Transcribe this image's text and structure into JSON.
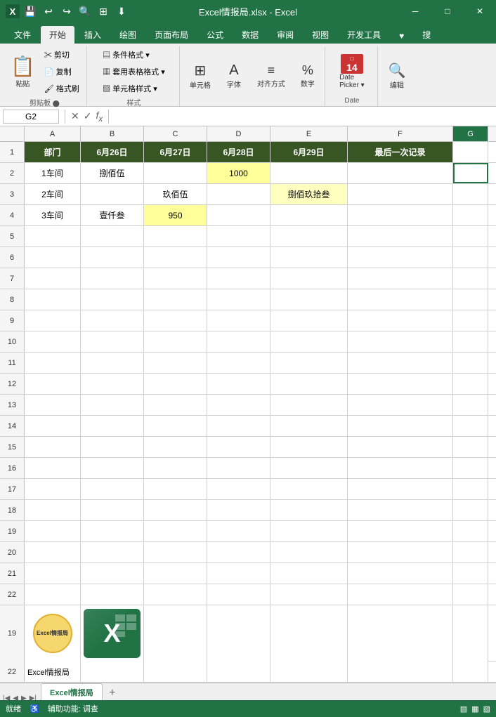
{
  "titlebar": {
    "title": "Excel情报局.xlsx - Excel",
    "min": "─",
    "max": "□",
    "close": "✕"
  },
  "ribbon": {
    "tabs": [
      "文件",
      "开始",
      "插入",
      "绘图",
      "页面布局",
      "公式",
      "数据",
      "审阅",
      "视图",
      "开发工具",
      "♥",
      "搜"
    ],
    "active_tab": "开始",
    "groups": [
      {
        "name": "剪贴板",
        "items": [
          "粘贴",
          "剪切",
          "复制",
          "格式刷"
        ]
      },
      {
        "name": "样式",
        "items": [
          "条件格式▾",
          "套用表格格式▾",
          "单元格样式▾"
        ]
      },
      {
        "name": "",
        "items": [
          "单元格",
          "字体",
          "对齐方式",
          "数字"
        ]
      },
      {
        "name": "Date",
        "items": [
          "DatePicker▾"
        ]
      },
      {
        "name": "",
        "items": [
          "编辑"
        ]
      }
    ]
  },
  "formula_bar": {
    "cell_ref": "G2",
    "formula": ""
  },
  "columns": {
    "headers": [
      "A",
      "B",
      "C",
      "D",
      "E",
      "F",
      "G"
    ]
  },
  "rows": [
    {
      "row_num": "1",
      "cells": [
        {
          "col": "A",
          "value": "部门",
          "style": "header"
        },
        {
          "col": "B",
          "value": "6月26日",
          "style": "header"
        },
        {
          "col": "C",
          "value": "6月27日",
          "style": "header"
        },
        {
          "col": "D",
          "value": "6月28日",
          "style": "header"
        },
        {
          "col": "E",
          "value": "6月29日",
          "style": "header"
        },
        {
          "col": "F",
          "value": "最后一次记录",
          "style": "header"
        },
        {
          "col": "G",
          "value": "",
          "style": "normal"
        }
      ]
    },
    {
      "row_num": "2",
      "cells": [
        {
          "col": "A",
          "value": "1车间",
          "style": "normal"
        },
        {
          "col": "B",
          "value": "捌佰伍",
          "style": "normal"
        },
        {
          "col": "C",
          "value": "",
          "style": "normal"
        },
        {
          "col": "D",
          "value": "1000",
          "style": "highlight-yellow"
        },
        {
          "col": "E",
          "value": "",
          "style": "normal"
        },
        {
          "col": "F",
          "value": "",
          "style": "normal"
        },
        {
          "col": "G",
          "value": "",
          "style": "selected-cell"
        }
      ]
    },
    {
      "row_num": "3",
      "cells": [
        {
          "col": "A",
          "value": "2车间",
          "style": "normal"
        },
        {
          "col": "B",
          "value": "",
          "style": "normal"
        },
        {
          "col": "C",
          "value": "玖佰伍",
          "style": "normal"
        },
        {
          "col": "D",
          "value": "",
          "style": "normal"
        },
        {
          "col": "E",
          "value": "捌佰玖拾叁",
          "style": "highlight-light"
        },
        {
          "col": "F",
          "value": "",
          "style": "normal"
        },
        {
          "col": "G",
          "value": "",
          "style": "normal"
        }
      ]
    },
    {
      "row_num": "4",
      "cells": [
        {
          "col": "A",
          "value": "3车间",
          "style": "normal"
        },
        {
          "col": "B",
          "value": "壹仟叁",
          "style": "normal"
        },
        {
          "col": "C",
          "value": "950",
          "style": "highlight-yellow"
        },
        {
          "col": "D",
          "value": "",
          "style": "normal"
        },
        {
          "col": "E",
          "value": "",
          "style": "normal"
        },
        {
          "col": "F",
          "value": "",
          "style": "normal"
        },
        {
          "col": "G",
          "value": "",
          "style": "normal"
        }
      ]
    }
  ],
  "empty_rows": [
    "5",
    "6",
    "7",
    "8",
    "9",
    "10",
    "11",
    "12",
    "13",
    "14",
    "15",
    "16",
    "17",
    "18",
    "19",
    "20",
    "21",
    "22"
  ],
  "sheet_tabs": {
    "sheets": [
      "Excel情报局"
    ],
    "active": "Excel情报局"
  },
  "status_bar": {
    "status": "就绪",
    "assist": "辅助功能: 调查",
    "layout_btns": [
      "▤",
      "▦",
      "▧"
    ]
  },
  "logo": {
    "circle_text": "Excel情报局",
    "excel_label": "X"
  }
}
